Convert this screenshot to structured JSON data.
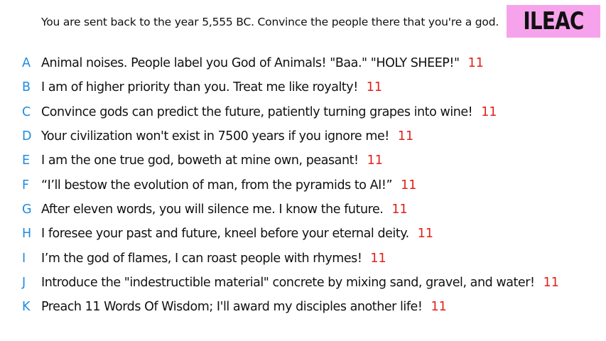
{
  "prompt": "You are sent back to the year 5,555 BC. Convince the people there that you're a god.",
  "badge": {
    "label": "ILEAC",
    "color": "#f7a3ec"
  },
  "colors": {
    "letter": "#1e8be0",
    "count": "#e0201b",
    "text": "#111111"
  },
  "answers": [
    {
      "letter": "A",
      "text": "Animal noises. People label you God of Animals! \"Baa.\" \"HOLY SHEEP!\"",
      "count": "11"
    },
    {
      "letter": "B",
      "text": "I am of higher priority than you. Treat me like royalty!",
      "count": "11"
    },
    {
      "letter": "C",
      "text": "Convince gods can predict the future, patiently turning grapes into wine!",
      "count": "11"
    },
    {
      "letter": "D",
      "text": "Your civilization won't exist in 7500 years if you ignore me!",
      "count": "11"
    },
    {
      "letter": "E",
      "text": "I am the one true god, boweth at mine own, peasant!",
      "count": "11"
    },
    {
      "letter": "F",
      "text": "“I’ll bestow the evolution of man, from the pyramids to AI!”",
      "count": "11"
    },
    {
      "letter": "G",
      "text": "After eleven words, you will silence me. I know the future.",
      "count": "11"
    },
    {
      "letter": "H",
      "text": "I foresee your past and future, kneel before your eternal deity.",
      "count": "11"
    },
    {
      "letter": "I",
      "text": "I’m the god of flames, I can roast people with rhymes!",
      "count": "11"
    },
    {
      "letter": "J",
      "text": "Introduce the \"indestructible material\" concrete by mixing sand, gravel, and water!",
      "count": "11"
    },
    {
      "letter": "K",
      "text": "Preach 11 Words Of Wisdom; I'll award my disciples another life!",
      "count": "11"
    }
  ]
}
